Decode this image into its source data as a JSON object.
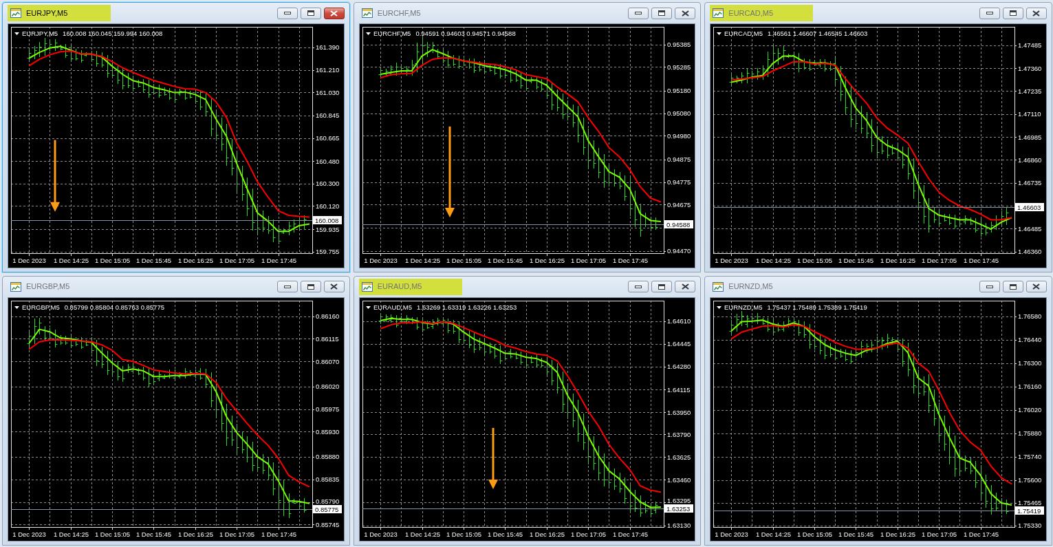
{
  "windows": [
    {
      "title": "EURJPY,M5",
      "active": true,
      "highlighted": true,
      "arrow": true,
      "chart": {
        "symbol": "EURJPY,M5",
        "quote": "160.008 160.045 159.994 160.008",
        "chart_data": {
          "type": "line",
          "grid": true,
          "categories": [
            "1 Dec 2023",
            null,
            null,
            null,
            "1 Dec 14:25",
            null,
            null,
            null,
            "1 Dec 15:05",
            null,
            null,
            null,
            "1 Dec 15:45",
            null,
            null,
            null,
            "1 Dec 16:25",
            null,
            null,
            null,
            "1 Dec 17:05",
            null,
            null,
            null,
            "1 Dec 17:45",
            null,
            null,
            null
          ],
          "ylim": [
            159.742,
            161.555
          ],
          "yticks": [
            {
              "value": 161.39,
              "label": "161.390"
            },
            {
              "value": 161.21,
              "label": "161.210"
            },
            {
              "value": 161.03,
              "label": "161.030"
            },
            {
              "value": 160.845,
              "label": "160.845"
            },
            {
              "value": 160.665,
              "label": "160.665"
            },
            {
              "value": 160.48,
              "label": "160.480"
            },
            {
              "value": 160.3,
              "label": "160.300"
            },
            {
              "value": 160.12,
              "label": "160.120"
            },
            {
              "value": 159.935,
              "label": "159.935"
            },
            {
              "value": 159.755,
              "label": "159.755"
            }
          ],
          "series": [
            {
              "color": "#7cfc00",
              "values": [
                161.304,
                161.35,
                161.386,
                161.399,
                161.368,
                161.337,
                161.337,
                161.313,
                161.239,
                161.175,
                161.124,
                161.105,
                161.069,
                161.05,
                161.028,
                161.032,
                161.013,
                160.973,
                160.817,
                160.679,
                160.459,
                160.257,
                160.064,
                159.999,
                159.917,
                159.917,
                159.963,
                159.977
              ]
            },
            {
              "color": "#ff0000",
              "values": [
                161.243,
                161.295,
                161.331,
                161.355,
                161.362,
                161.34,
                161.337,
                161.318,
                161.276,
                161.227,
                161.19,
                161.157,
                161.125,
                161.102,
                161.078,
                161.059,
                161.056,
                161.028,
                160.955,
                160.83,
                160.624,
                160.477,
                160.312,
                160.192,
                160.082,
                160.045,
                160.036,
                160.032
              ]
            }
          ],
          "ref_lines": [
            {
              "axis": "y",
              "value": 160.008,
              "label": "160.008"
            }
          ]
        }
      }
    },
    {
      "title": "EURCHF,M5",
      "active": false,
      "highlighted": false,
      "arrow": true,
      "chart": {
        "symbol": "EURCHF,M5",
        "quote": "0.94591 0.94603 0.94571 0.94588",
        "chart_data": {
          "type": "line",
          "grid": true,
          "categories": [
            "1 Dec 2023",
            null,
            null,
            null,
            "1 Dec 14:25",
            null,
            null,
            null,
            "1 Dec 15:05",
            null,
            null,
            null,
            "1 Dec 15:45",
            null,
            null,
            null,
            "1 Dec 16:25",
            null,
            null,
            null,
            "1 Dec 17:05",
            null,
            null,
            null,
            "1 Dec 17:45",
            null,
            null,
            null
          ],
          "ylim": [
            0.9446,
            0.95463
          ],
          "yticks": [
            {
              "value": 0.95385,
              "label": "0.95385"
            },
            {
              "value": 0.95285,
              "label": "0.95285"
            },
            {
              "value": 0.9518,
              "label": "0.95180"
            },
            {
              "value": 0.9508,
              "label": "0.95080"
            },
            {
              "value": 0.9498,
              "label": "0.94980"
            },
            {
              "value": 0.94875,
              "label": "0.94875"
            },
            {
              "value": 0.94775,
              "label": "0.94775"
            },
            {
              "value": 0.94675,
              "label": "0.94675"
            },
            {
              "value": 0.9447,
              "label": "0.94470"
            }
          ],
          "series": [
            {
              "color": "#7cfc00",
              "values": [
                0.95253,
                0.95261,
                0.95268,
                0.95268,
                0.95334,
                0.95362,
                0.95344,
                0.95324,
                0.95312,
                0.95304,
                0.95291,
                0.95283,
                0.95273,
                0.95255,
                0.95227,
                0.95227,
                0.95204,
                0.95156,
                0.9511,
                0.95065,
                0.94958,
                0.94887,
                0.94821,
                0.94797,
                0.94744,
                0.94635,
                0.94605,
                0.946
              ]
            },
            {
              "color": "#ff0000",
              "values": [
                0.95237,
                0.95251,
                0.95255,
                0.95257,
                0.95293,
                0.95319,
                0.95326,
                0.95324,
                0.95312,
                0.95306,
                0.95299,
                0.95296,
                0.95286,
                0.95273,
                0.95251,
                0.95243,
                0.95233,
                0.95197,
                0.95166,
                0.95131,
                0.9506,
                0.94999,
                0.94928,
                0.94887,
                0.94831,
                0.94755,
                0.94704,
                0.94687
              ]
            }
          ],
          "ref_lines": [
            {
              "axis": "y",
              "value": 0.94588,
              "label": "0.94588"
            }
          ]
        }
      }
    },
    {
      "title": "EURCAD,M5",
      "active": false,
      "highlighted": true,
      "arrow": false,
      "chart": {
        "symbol": "EURCAD,M5",
        "quote": "1.46561 1.46607 1.46545 1.46603",
        "chart_data": {
          "type": "line",
          "grid": true,
          "categories": [
            "1 Dec 2023",
            null,
            null,
            null,
            "1 Dec 14:25",
            null,
            null,
            null,
            "1 Dec 15:05",
            null,
            null,
            null,
            "1 Dec 15:45",
            null,
            null,
            null,
            "1 Dec 16:25",
            null,
            null,
            null,
            "1 Dec 17:05",
            null,
            null,
            null,
            "1 Dec 17:45",
            null,
            null,
            null
          ],
          "ylim": [
            1.46351,
            1.47585
          ],
          "yticks": [
            {
              "value": 1.47485,
              "label": "1.47485"
            },
            {
              "value": 1.4736,
              "label": "1.47360"
            },
            {
              "value": 1.47235,
              "label": "1.47235"
            },
            {
              "value": 1.4711,
              "label": "1.47110"
            },
            {
              "value": 1.46985,
              "label": "1.46985"
            },
            {
              "value": 1.4686,
              "label": "1.46860"
            },
            {
              "value": 1.46735,
              "label": "1.46735"
            },
            {
              "value": 1.46485,
              "label": "1.46485"
            },
            {
              "value": 1.4636,
              "label": "1.46360"
            }
          ],
          "series": [
            {
              "color": "#7cfc00",
              "values": [
                1.47283,
                1.47295,
                1.47311,
                1.4732,
                1.47386,
                1.47426,
                1.47426,
                1.47395,
                1.47386,
                1.47389,
                1.47376,
                1.47251,
                1.47141,
                1.47076,
                1.46983,
                1.46939,
                1.46916,
                1.46876,
                1.46726,
                1.46595,
                1.46558,
                1.46545,
                1.46533,
                1.46533,
                1.46508,
                1.46483,
                1.4652,
                1.46545
              ]
            },
            {
              "color": "#ff0000",
              "values": [
                1.47295,
                1.47301,
                1.47308,
                1.47314,
                1.47345,
                1.4737,
                1.47395,
                1.47395,
                1.47383,
                1.47386,
                1.47376,
                1.47301,
                1.47233,
                1.4717,
                1.47089,
                1.47033,
                1.46995,
                1.46951,
                1.46851,
                1.46758,
                1.46683,
                1.46639,
                1.46608,
                1.46589,
                1.46564,
                1.46533,
                1.46533,
                1.46545
              ]
            }
          ],
          "ref_lines": [
            {
              "axis": "y",
              "value": 1.46603,
              "label": "1.46603"
            }
          ]
        }
      }
    },
    {
      "title": "EURGBP,M5",
      "active": false,
      "highlighted": false,
      "arrow": false,
      "chart": {
        "symbol": "EURGBP,M5",
        "quote": "0.85799 0.85804 0.85763 0.85775",
        "chart_data": {
          "type": "line",
          "grid": true,
          "categories": [
            "1 Dec 2023",
            null,
            null,
            null,
            "1 Dec 14:25",
            null,
            null,
            null,
            "1 Dec 15:05",
            null,
            null,
            null,
            "1 Dec 15:45",
            null,
            null,
            null,
            "1 Dec 16:25",
            null,
            null,
            null,
            "1 Dec 17:05",
            null,
            null,
            null,
            "1 Dec 17:45",
            null,
            null,
            null
          ],
          "ylim": [
            0.8574,
            0.86191
          ],
          "yticks": [
            {
              "value": 0.8616,
              "label": "0.86160"
            },
            {
              "value": 0.86115,
              "label": "0.86115"
            },
            {
              "value": 0.8607,
              "label": "0.86070"
            },
            {
              "value": 0.8602,
              "label": "0.86020"
            },
            {
              "value": 0.85975,
              "label": "0.85975"
            },
            {
              "value": 0.8593,
              "label": "0.85930"
            },
            {
              "value": 0.8588,
              "label": "0.85880"
            },
            {
              "value": 0.85835,
              "label": "0.85835"
            },
            {
              "value": 0.8579,
              "label": "0.85790"
            },
            {
              "value": 0.85745,
              "label": "0.85745"
            }
          ],
          "series": [
            {
              "color": "#7cfc00",
              "values": [
                0.86106,
                0.86134,
                0.86129,
                0.86117,
                0.86115,
                0.86111,
                0.86108,
                0.86087,
                0.86067,
                0.86051,
                0.86055,
                0.86051,
                0.8604,
                0.8604,
                0.86042,
                0.86042,
                0.86045,
                0.86044,
                0.8601,
                0.8596,
                0.85928,
                0.85905,
                0.8588,
                0.85866,
                0.85832,
                0.85792,
                0.85791,
                0.85787
              ]
            },
            {
              "color": "#ff0000",
              "values": [
                0.86094,
                0.86109,
                0.86113,
                0.86113,
                0.86112,
                0.86111,
                0.86109,
                0.86103,
                0.86092,
                0.86074,
                0.8607,
                0.86062,
                0.86053,
                0.8605,
                0.86047,
                0.86045,
                0.86046,
                0.86045,
                0.86028,
                0.85996,
                0.85971,
                0.85946,
                0.85923,
                0.85903,
                0.85877,
                0.85843,
                0.8583,
                0.8582
              ]
            }
          ],
          "ref_lines": [
            {
              "axis": "y",
              "value": 0.85775,
              "label": "0.85775"
            }
          ]
        }
      }
    },
    {
      "title": "EURAUD,M5",
      "active": false,
      "highlighted": true,
      "arrow": true,
      "chart": {
        "symbol": "EURAUD,M5",
        "quote": "1.63269 1.63319 1.63226 1.63253",
        "chart_data": {
          "type": "line",
          "grid": true,
          "categories": [
            "1 Dec 2023",
            null,
            null,
            null,
            "1 Dec 14:25",
            null,
            null,
            null,
            "1 Dec 15:05",
            null,
            null,
            null,
            "1 Dec 15:45",
            null,
            null,
            null,
            "1 Dec 16:25",
            null,
            null,
            null,
            "1 Dec 17:05",
            null,
            null,
            null,
            "1 Dec 17:45",
            null,
            null,
            null
          ],
          "ylim": [
            1.63118,
            1.64758
          ],
          "yticks": [
            {
              "value": 1.6461,
              "label": "1.64610"
            },
            {
              "value": 1.64445,
              "label": "1.64445"
            },
            {
              "value": 1.6428,
              "label": "1.64280"
            },
            {
              "value": 1.64115,
              "label": "1.64115"
            },
            {
              "value": 1.6395,
              "label": "1.63950"
            },
            {
              "value": 1.6379,
              "label": "1.63790"
            },
            {
              "value": 1.63625,
              "label": "1.63625"
            },
            {
              "value": 1.6346,
              "label": "1.63460"
            },
            {
              "value": 1.63295,
              "label": "1.63295"
            },
            {
              "value": 1.6313,
              "label": "1.63130"
            }
          ],
          "series": [
            {
              "color": "#7cfc00",
              "values": [
                1.64613,
                1.6463,
                1.64622,
                1.64622,
                1.646,
                1.64588,
                1.64605,
                1.64588,
                1.6453,
                1.6448,
                1.64447,
                1.64414,
                1.64376,
                1.64372,
                1.64348,
                1.64339,
                1.64311,
                1.6424,
                1.64073,
                1.63949,
                1.63775,
                1.63633,
                1.63525,
                1.63467,
                1.63376,
                1.63301,
                1.6326,
                1.63263
              ]
            },
            {
              "color": "#ff0000",
              "values": [
                1.64555,
                1.64583,
                1.64597,
                1.64597,
                1.64605,
                1.64592,
                1.64605,
                1.64593,
                1.64563,
                1.6453,
                1.645,
                1.64472,
                1.64434,
                1.64414,
                1.64389,
                1.64372,
                1.64361,
                1.64323,
                1.64215,
                1.6409,
                1.63957,
                1.63849,
                1.63716,
                1.63617,
                1.63534,
                1.63417,
                1.63384,
                1.63371
              ]
            }
          ],
          "ref_lines": [
            {
              "axis": "y",
              "value": 1.63253,
              "label": "1.63253"
            }
          ]
        }
      }
    },
    {
      "title": "EURNZD,M5",
      "active": false,
      "highlighted": false,
      "arrow": false,
      "chart": {
        "symbol": "EURNZD,M5",
        "quote": "1.75437 1.75489 1.75389 1.75419",
        "chart_data": {
          "type": "line",
          "grid": true,
          "categories": [
            "1 Dec 2023",
            null,
            null,
            null,
            "1 Dec 14:25",
            null,
            null,
            null,
            "1 Dec 15:05",
            null,
            null,
            null,
            "1 Dec 15:45",
            null,
            null,
            null,
            "1 Dec 16:25",
            null,
            null,
            null,
            "1 Dec 17:05",
            null,
            null,
            null,
            "1 Dec 17:45",
            null,
            null,
            null
          ],
          "ylim": [
            1.7532,
            1.76673
          ],
          "yticks": [
            {
              "value": 1.7658,
              "label": "1.76580"
            },
            {
              "value": 1.7644,
              "label": "1.76440"
            },
            {
              "value": 1.763,
              "label": "1.76300"
            },
            {
              "value": 1.7616,
              "label": "1.76160"
            },
            {
              "value": 1.7602,
              "label": "1.76020"
            },
            {
              "value": 1.7588,
              "label": "1.75880"
            },
            {
              "value": 1.7574,
              "label": "1.75740"
            },
            {
              "value": 1.756,
              "label": "1.75600"
            },
            {
              "value": 1.75465,
              "label": "1.75465"
            },
            {
              "value": 1.7533,
              "label": "1.75330"
            }
          ],
          "series": [
            {
              "color": "#7cfc00",
              "values": [
                1.76492,
                1.76547,
                1.76551,
                1.76557,
                1.76533,
                1.7652,
                1.7654,
                1.7652,
                1.76458,
                1.7641,
                1.76379,
                1.76359,
                1.76346,
                1.76376,
                1.7639,
                1.76417,
                1.76431,
                1.76362,
                1.76211,
                1.76163,
                1.75992,
                1.75855,
                1.75732,
                1.75707,
                1.75629,
                1.75519,
                1.75464,
                1.75451
              ]
            },
            {
              "color": "#ff0000",
              "values": [
                1.76444,
                1.76485,
                1.76503,
                1.7652,
                1.76524,
                1.76516,
                1.76529,
                1.7652,
                1.76488,
                1.76458,
                1.76424,
                1.764,
                1.76383,
                1.76383,
                1.7639,
                1.7641,
                1.7642,
                1.7639,
                1.763,
                1.76252,
                1.76136,
                1.76006,
                1.75896,
                1.75828,
                1.7578,
                1.75684,
                1.75615,
                1.75577
              ]
            }
          ],
          "ref_lines": [
            {
              "axis": "y",
              "value": 1.75419,
              "label": "1.75419"
            }
          ]
        }
      }
    }
  ]
}
